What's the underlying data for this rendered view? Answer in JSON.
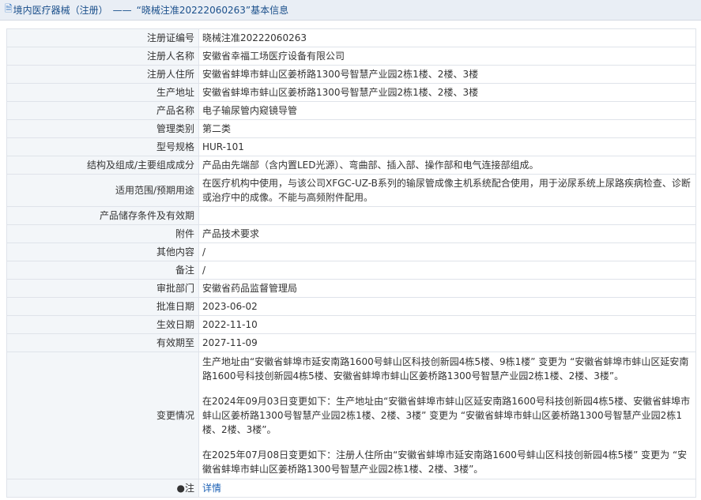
{
  "header": {
    "icon": "document-icon",
    "category": "境内医疗器械（注册）",
    "separator": "——",
    "title": "“晓械注准20222060263”基本信息"
  },
  "rows": [
    {
      "label": "注册证编号",
      "value": "晓械注准20222060263"
    },
    {
      "label": "注册人名称",
      "value": "安徽省幸福工场医疗设备有限公司"
    },
    {
      "label": "注册人住所",
      "value": "安徽省蚌埠市蚌山区姜桥路1300号智慧产业园2栋1楼、2楼、3楼"
    },
    {
      "label": "生产地址",
      "value": "安徽省蚌埠市蚌山区姜桥路1300号智慧产业园2栋1楼、2楼、3楼"
    },
    {
      "label": "产品名称",
      "value": "电子输尿管内窥镜导管"
    },
    {
      "label": "管理类别",
      "value": "第二类"
    },
    {
      "label": "型号规格",
      "value": "HUR-101"
    },
    {
      "label": "结构及组成/主要组成成分",
      "value": "产品由先端部（含内置LED光源）、弯曲部、插入部、操作部和电气连接部组成。"
    },
    {
      "label": "适用范围/预期用途",
      "value": "在医疗机构中使用，与该公司XFGC-UZ-B系列的输尿管成像主机系统配合使用，用于泌尿系统上尿路疾病检查、诊断或治疗中的成像。不能与高频附件配用。"
    },
    {
      "label": "产品储存条件及有效期",
      "value": ""
    },
    {
      "label": "附件",
      "value": "产品技术要求"
    },
    {
      "label": "其他内容",
      "value": "/"
    },
    {
      "label": "备注",
      "value": "/"
    },
    {
      "label": "审批部门",
      "value": "安徽省药品监督管理局"
    },
    {
      "label": "批准日期",
      "value": "2023-06-02"
    },
    {
      "label": "生效日期",
      "value": "2022-11-10"
    },
    {
      "label": "有效期至",
      "value": "2027-11-09"
    }
  ],
  "changes": {
    "label": "变更情况",
    "entries": [
      "生产地址由“安徽省蚌埠市延安南路1600号蚌山区科技创新园4栋5楼、9栋1楼” 变更为 “安徽省蚌埠市蚌山区延安南路1600号科技创新园4栋5楼、安徽省蚌埠市蚌山区姜桥路1300号智慧产业园2栋1楼、2楼、3楼”。",
      "在2024年09月03日变更如下：生产地址由“安徽省蚌埠市蚌山区延安南路1600号科技创新园4栋5楼、安徽省蚌埠市蚌山区姜桥路1300号智慧产业园2栋1楼、2楼、3楼” 变更为 “安徽省蚌埠市蚌山区姜桥路1300号智慧产业园2栋1楼、2楼、3楼”。",
      "在2025年07月08日变更如下：注册人住所由“安徽省蚌埠市延安南路1600号蚌山区科技创新园4栋5楼” 变更为 “安徽省蚌埠市蚌山区姜桥路1300号智慧产业园2栋1楼、2楼、3楼”。"
    ]
  },
  "note_row": {
    "label": "●注",
    "value": "详情"
  }
}
